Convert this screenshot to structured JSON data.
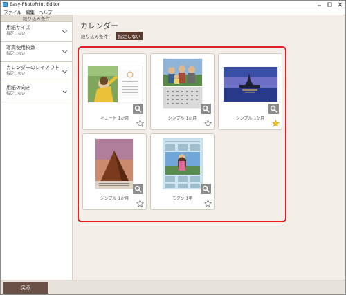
{
  "window": {
    "title": "Easy-PhotoPrint Editor",
    "controls": [
      "minimize",
      "maximize",
      "close"
    ]
  },
  "menubar": {
    "items": [
      "ファイル",
      "編集",
      "ヘルプ"
    ]
  },
  "sidebar": {
    "header": "絞り込み条件",
    "filters": [
      {
        "title": "用紙サイズ",
        "value": "指定しない"
      },
      {
        "title": "写真使用枚数",
        "value": "指定しない"
      },
      {
        "title": "カレンダーのレイアウト",
        "value": "指定しない"
      },
      {
        "title": "用紙の向き",
        "value": "指定しない"
      }
    ]
  },
  "main": {
    "title": "カレンダー",
    "filter_label": "絞り込み条件：",
    "filter_value": "指定しない"
  },
  "templates": [
    {
      "label": "キュート 1か月",
      "favorite": false
    },
    {
      "label": "シンプル 1か月",
      "favorite": false
    },
    {
      "label": "シンプル 1か月",
      "favorite": true
    },
    {
      "label": "シンプル 1か月",
      "favorite": false
    },
    {
      "label": "モダン 1年",
      "favorite": false
    }
  ],
  "footer": {
    "back_label": "戻る"
  },
  "colors": {
    "accent_brown": "#6b5048",
    "selection_red": "#e31e24",
    "favorite_star": "#f5c518"
  }
}
